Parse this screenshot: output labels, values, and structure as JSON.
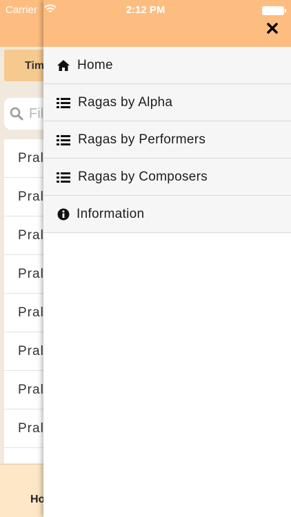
{
  "status_bar": {
    "carrier": "Carrier",
    "time": "2:12 PM"
  },
  "background": {
    "tab_label": "Tim",
    "search_placeholder": "Fil",
    "list_items": [
      "Pral",
      "Pral",
      "Pral",
      "Pral",
      "Pral",
      "Pral",
      "Pral",
      "Pral"
    ],
    "footer_label": "Ho"
  },
  "drawer": {
    "close_icon": "close-x-icon",
    "menu": [
      {
        "label": "Home",
        "icon": "home-icon"
      },
      {
        "label": "Ragas by Alpha",
        "icon": "list-icon"
      },
      {
        "label": "Ragas by Performers",
        "icon": "list-icon"
      },
      {
        "label": "Ragas by Composers",
        "icon": "list-icon"
      },
      {
        "label": "Information",
        "icon": "info-circle-icon"
      }
    ]
  },
  "colors": {
    "header": "#fdbd80",
    "background": "#f1e9dc"
  }
}
